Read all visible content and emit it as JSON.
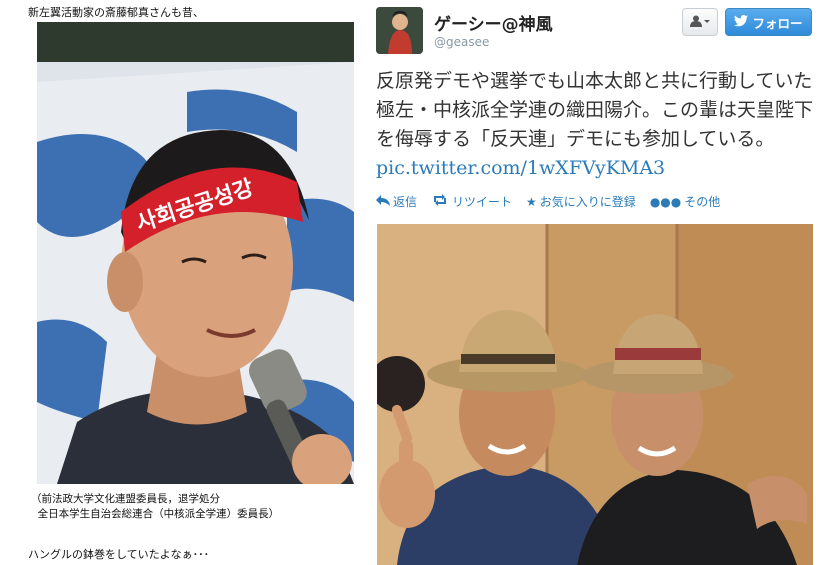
{
  "blog": {
    "caption_top": "新左翼活動家の斎藤郁真さんも昔、",
    "photo_headband_text": "사회공공성강",
    "caption_line1": "（前法政大学文化連盟委員長，退学処分",
    "caption_line2": "  全日本学生自治会総連合（中核派全学連）委員長）",
    "caption_bottom": "ハングルの鉢巻をしていたよなぁ･･･"
  },
  "tweet": {
    "display_name": "ゲーシー@神風",
    "handle": "@geasee",
    "user_button_icon": "person-dropdown-icon",
    "follow_label": "フォロー",
    "text": "反原発デモや選挙でも山本太郎と共に行動していた極左・中核派全学連の織田陽介。この輩は天皇陛下を侮辱する「反天連」デモにも参加している。",
    "link": "pic.twitter.com/1wXFVyKMA3",
    "actions": {
      "reply": "返信",
      "retweet": "リツイート",
      "favorite": "お気に入りに登録",
      "more": "その他"
    }
  },
  "colors": {
    "link": "#2b7bb9",
    "follow_bg": "#2e8ad8",
    "headband": "#d4202a"
  }
}
